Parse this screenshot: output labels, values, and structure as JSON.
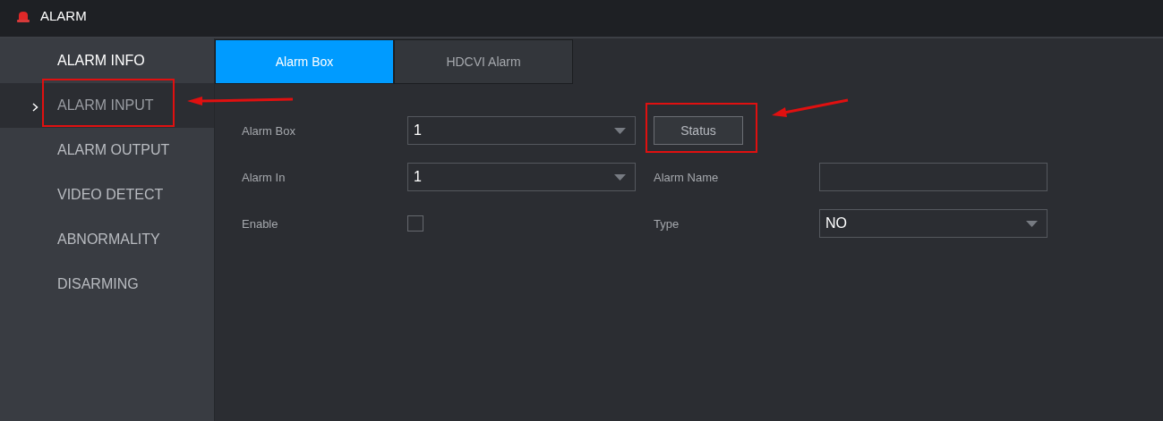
{
  "window": {
    "title": "ALARM"
  },
  "sidebar": {
    "items": [
      {
        "label": "ALARM INFO",
        "selected": false
      },
      {
        "label": "ALARM INPUT",
        "selected": true
      },
      {
        "label": "ALARM OUTPUT",
        "selected": false
      },
      {
        "label": "VIDEO DETECT",
        "selected": false
      },
      {
        "label": "ABNORMALITY",
        "selected": false
      },
      {
        "label": "DISARMING",
        "selected": false
      }
    ]
  },
  "tabs": [
    {
      "label": "Alarm Box",
      "selected": true
    },
    {
      "label": "HDCVI Alarm",
      "selected": false
    }
  ],
  "form": {
    "rows": [
      {
        "fields": [
          {
            "kind": "select",
            "label": "Alarm Box",
            "value": "1"
          },
          {
            "kind": "button",
            "label": "Status"
          }
        ]
      },
      {
        "fields": [
          {
            "kind": "select",
            "label": "Alarm In",
            "value": "1"
          },
          {
            "kind": "text",
            "label": "Alarm Name"
          }
        ]
      },
      {
        "fields": [
          {
            "kind": "checkbox",
            "label": "Enable",
            "checked": false
          },
          {
            "kind": "select",
            "label": "Type",
            "value": "NO"
          }
        ]
      }
    ]
  }
}
